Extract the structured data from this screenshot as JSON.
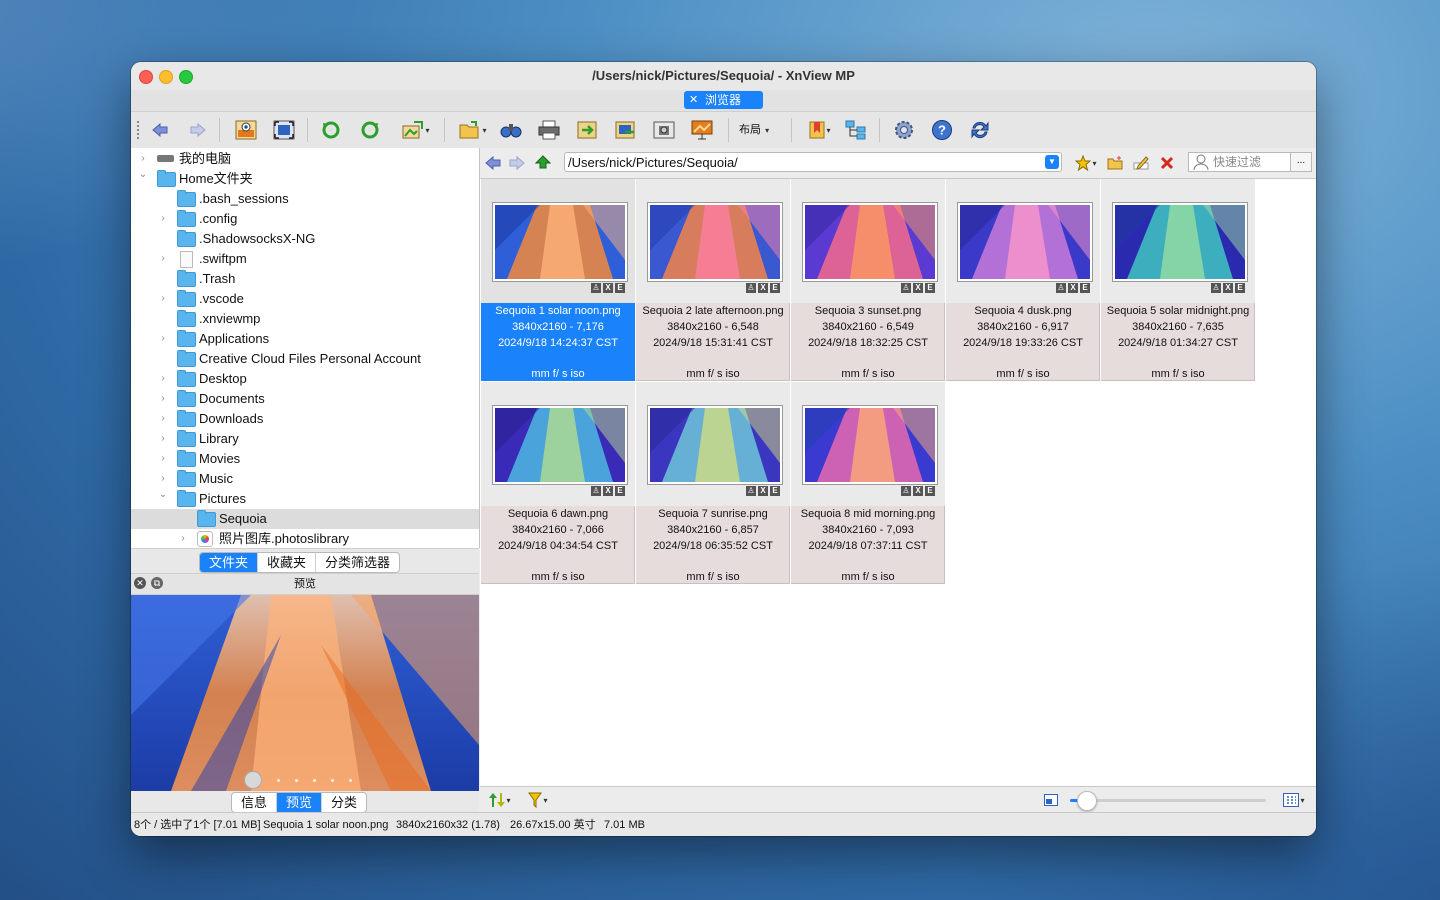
{
  "window": {
    "title": "/Users/nick/Pictures/Sequoia/ - XnView MP"
  },
  "doc_tab": {
    "label": "浏览器"
  },
  "toolbar": {
    "layout_label": "布局"
  },
  "tree": {
    "items": [
      {
        "label": "我的电脑",
        "icon": "drive-icon",
        "depth": 0,
        "chevron": ">"
      },
      {
        "label": "Home文件夹",
        "icon": "folder-icon",
        "depth": 0,
        "chevron": "v"
      },
      {
        "label": ".bash_sessions",
        "icon": "folder-icon",
        "depth": 1,
        "chevron": ""
      },
      {
        "label": ".config",
        "icon": "folder-icon",
        "depth": 1,
        "chevron": ">"
      },
      {
        "label": ".ShadowsocksX-NG",
        "icon": "folder-icon",
        "depth": 1,
        "chevron": ""
      },
      {
        "label": ".swiftpm",
        "icon": "file-icon",
        "depth": 1,
        "chevron": ">"
      },
      {
        "label": ".Trash",
        "icon": "folder-icon",
        "depth": 1,
        "chevron": ""
      },
      {
        "label": ".vscode",
        "icon": "folder-icon",
        "depth": 1,
        "chevron": ">"
      },
      {
        "label": ".xnviewmp",
        "icon": "folder-icon",
        "depth": 1,
        "chevron": ""
      },
      {
        "label": "Applications",
        "icon": "folder-icon",
        "depth": 1,
        "chevron": ">"
      },
      {
        "label": "Creative Cloud Files Personal Account",
        "icon": "folder-icon",
        "depth": 1,
        "chevron": ""
      },
      {
        "label": "Desktop",
        "icon": "folder-icon",
        "depth": 1,
        "chevron": ">"
      },
      {
        "label": "Documents",
        "icon": "folder-icon",
        "depth": 1,
        "chevron": ">"
      },
      {
        "label": "Downloads",
        "icon": "folder-icon",
        "depth": 1,
        "chevron": ">"
      },
      {
        "label": "Library",
        "icon": "folder-icon",
        "depth": 1,
        "chevron": ">"
      },
      {
        "label": "Movies",
        "icon": "folder-icon",
        "depth": 1,
        "chevron": ">"
      },
      {
        "label": "Music",
        "icon": "folder-icon",
        "depth": 1,
        "chevron": ">"
      },
      {
        "label": "Pictures",
        "icon": "folder-icon",
        "depth": 1,
        "chevron": "v"
      },
      {
        "label": "Sequoia",
        "icon": "folder-icon",
        "depth": 2,
        "chevron": "",
        "selected": true
      },
      {
        "label": "照片图库.photoslibrary",
        "icon": "photos-icon",
        "depth": 2,
        "chevron": ">"
      }
    ]
  },
  "panel_tabs": [
    "文件夹",
    "收藏夹",
    "分类筛选器"
  ],
  "preview": {
    "title": "预览"
  },
  "preview_tabs": [
    "信息",
    "预览",
    "分类"
  ],
  "address": {
    "path": "/Users/nick/Pictures/Sequoia/",
    "filter_placeholder": "快速过滤",
    "more": "..."
  },
  "thumbnails": [
    {
      "name": "Sequoia 1 solar noon.png",
      "dims": "3840x2160 - 7,176",
      "date": "2024/9/18 14:24:37 CST",
      "exif": "mm f/ s iso",
      "selected": true,
      "palette": "noon"
    },
    {
      "name": "Sequoia 2 late afternoon.png",
      "dims": "3840x2160 - 6,548",
      "date": "2024/9/18 15:31:41 CST",
      "exif": "mm f/ s iso",
      "palette": "afternoon"
    },
    {
      "name": "Sequoia 3 sunset.png",
      "dims": "3840x2160 - 6,549",
      "date": "2024/9/18 18:32:25 CST",
      "exif": "mm f/ s iso",
      "palette": "sunset"
    },
    {
      "name": "Sequoia 4 dusk.png",
      "dims": "3840x2160 - 6,917",
      "date": "2024/9/18 19:33:26 CST",
      "exif": "mm f/ s iso",
      "palette": "dusk"
    },
    {
      "name": "Sequoia 5 solar midnight.png",
      "dims": "3840x2160 - 7,635",
      "date": "2024/9/18 01:34:27 CST",
      "exif": "mm f/ s iso",
      "palette": "midnight"
    },
    {
      "name": "Sequoia 6 dawn.png",
      "dims": "3840x2160 - 7,066",
      "date": "2024/9/18 04:34:54 CST",
      "exif": "mm f/ s iso",
      "palette": "dawn"
    },
    {
      "name": "Sequoia 7 sunrise.png",
      "dims": "3840x2160 - 6,857",
      "date": "2024/9/18 06:35:52 CST",
      "exif": "mm f/ s iso",
      "palette": "sunrise"
    },
    {
      "name": "Sequoia 8 mid morning.png",
      "dims": "3840x2160 - 7,093",
      "date": "2024/9/18 07:37:11 CST",
      "exif": "mm f/ s iso",
      "palette": "morning"
    }
  ],
  "status": {
    "count": "8个 / 选中了1个 [7.01 MB]",
    "file": "Sequoia 1 solar noon.png",
    "resolution": "3840x2160x32 (1.78)",
    "print_size": "26.67x15.00 英寸",
    "size": "7.01 MB"
  },
  "zoom": {
    "level": 0.08
  },
  "colors": {
    "accent": "#1a82fb",
    "selected_cell": "#1a82fb",
    "cell_bg": "#e6dcdc"
  }
}
